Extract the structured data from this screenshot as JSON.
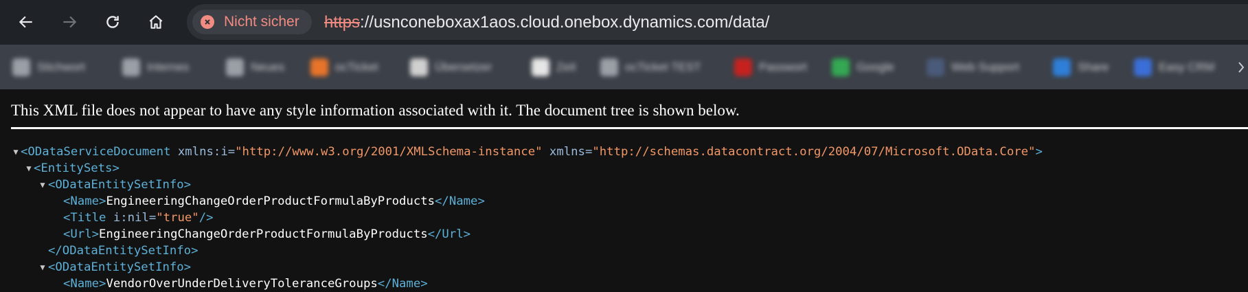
{
  "toolbar": {
    "back_icon": "back-arrow-icon",
    "forward_icon": "forward-arrow-icon",
    "reload_icon": "reload-icon",
    "home_icon": "home-icon",
    "security_label": "Nicht sicher",
    "url_scheme": "https",
    "url_rest": "://usnconeboxax1aos.cloud.onebox.dynamics.com/data/"
  },
  "bookmarks": [
    {
      "label": "Stichwort",
      "icon": "folder-icon",
      "color": "#9aa0a6"
    },
    {
      "label": "Internes",
      "icon": "folder-icon",
      "color": "#9aa0a6"
    },
    {
      "label": "Neues",
      "icon": "folder-icon",
      "color": "#9aa0a6"
    },
    {
      "label": "ocTicket",
      "icon": "app-icon",
      "color": "#e8742a"
    },
    {
      "label": "Übersetzer",
      "icon": "globe-icon",
      "color": "#d0d0d0"
    },
    {
      "label": "Zeit",
      "icon": "page-icon",
      "color": "#e6e6e6"
    },
    {
      "label": "ocTicket TEST",
      "icon": "globe-icon",
      "color": "#9aa0a6"
    },
    {
      "label": "Passwort",
      "icon": "app-icon",
      "color": "#c5221f"
    },
    {
      "label": "Google",
      "icon": "drive-icon",
      "color": "#34a853"
    },
    {
      "label": "Web Support",
      "icon": "app-icon",
      "color": "#4a5a7a"
    },
    {
      "label": "Share",
      "icon": "app-icon",
      "color": "#2f7fd8"
    },
    {
      "label": "Easy CRM",
      "icon": "app-icon",
      "color": "#3b6fd8"
    }
  ],
  "content": {
    "notice": "This XML file does not appear to have any style information associated with it. The document tree is shown below.",
    "lines": [
      {
        "toggle": "▼",
        "open": "<ODataServiceDocument",
        "attr1": " xmlns:i=",
        "val1": "\"http://www.w3.org/2001/XMLSchema-instance\"",
        "attr2": " xmlns=",
        "val2": "\"http://schemas.datacontract.org/2004/07/Microsoft.OData.Core\"",
        "close": ">"
      },
      {
        "toggle": "▼",
        "open": "<EntitySets>"
      },
      {
        "toggle": "▼",
        "open": "<ODataEntitySetInfo>"
      },
      {
        "open": "<Name>",
        "text": "EngineeringChangeOrderProductFormulaByProducts",
        "close": "</Name>"
      },
      {
        "open": "<Title",
        "attr1": " i:nil=",
        "val1": "\"true\"",
        "close": "/>"
      },
      {
        "open": "<Url>",
        "text": "EngineeringChangeOrderProductFormulaByProducts",
        "close": "</Url>"
      },
      {
        "open": "</ODataEntitySetInfo>"
      },
      {
        "toggle": "▼",
        "open": "<ODataEntitySetInfo>"
      },
      {
        "open": "<Name>",
        "text": "VendorOverUnderDeliveryToleranceGroups",
        "close": "</Name>"
      }
    ]
  }
}
